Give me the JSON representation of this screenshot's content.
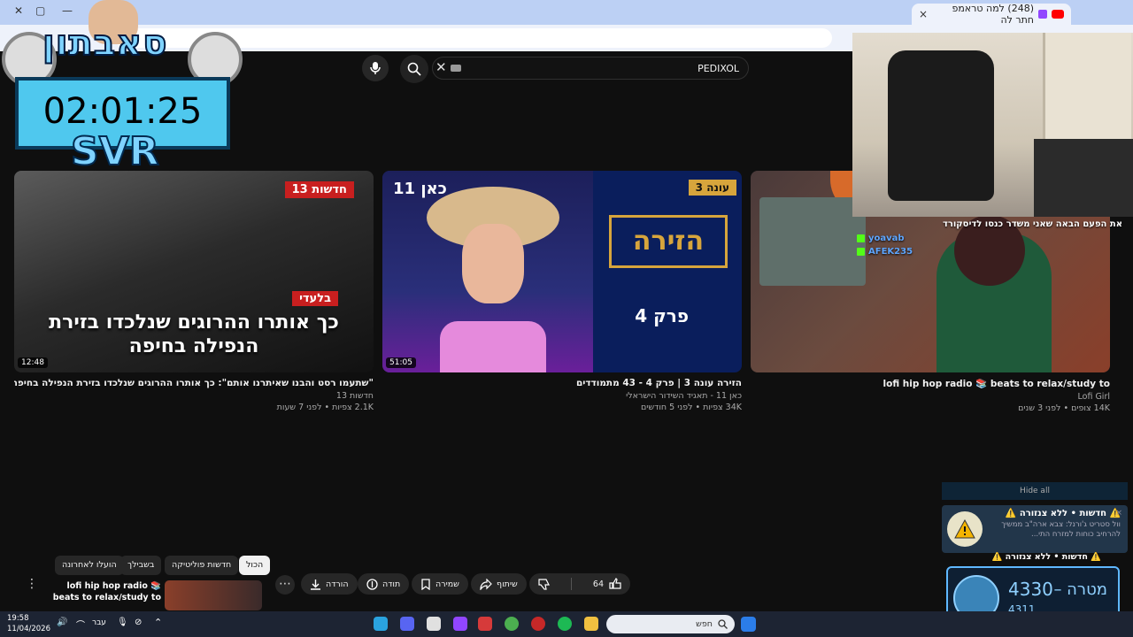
{
  "browser": {
    "tab_title": "(248) למה טראמפ חתר לה",
    "new_tab": "+",
    "tab_close": "×",
    "window_controls": [
      "▢",
      "—"
    ]
  },
  "youtube": {
    "search_value": "PEDIXOL",
    "videos": [
      {
        "thumb_badge": "חדשות 13",
        "thumb_exclusive": "בלעדי",
        "thumb_headline": "כך אותרו ההרוגים שנלכדו בזירת הנפילה בחיפה",
        "duration": "12:48",
        "title": "\"שתעמו רסט והבנו שאיתרנו אותם\": כך אותרו ההרוגים שנלכדו בזירת הנפילה בחיפה",
        "channel": "חדשות 13",
        "meta": "2.1K צפיות • לפני 7 שעות"
      },
      {
        "thumb_logo": "כאן 11",
        "thumb_season": "עונה 3",
        "thumb_show": "הזירה",
        "thumb_episode": "פרק 4",
        "duration": "51:05",
        "title": "הזירה עונה 3 | פרק 4 - 43 מתמודדים",
        "channel": "כאן 11 - תאגיד השידור הישראלי",
        "meta": "34K צפיות • לפני 5 חודשים"
      },
      {
        "duration": "",
        "title": "lofi hip hop radio 📚 beats to relax/study to",
        "channel": "Lofi Girl",
        "meta": "14K צופים • לפני 3 שנים"
      }
    ],
    "chips": [
      "הכול",
      "חדשות פוליטיקה",
      "בשבילך",
      "הועלו לאחרונה"
    ],
    "actions": {
      "likes": "64",
      "share": "שיתוף",
      "save": "שמירה",
      "thanks": "תודה",
      "download": "הורדה"
    },
    "mini_player_title": "lofi hip hop radio 📚 beats to relax/study to"
  },
  "overlay": {
    "streamer_name": "סאבתון",
    "timer": "02:01:25",
    "svr": "SVR",
    "chat_heading": "את הפעם הבאה שאני משדר כנסו לדיסקורד",
    "chat_users": [
      "yoavab",
      "AFEK235"
    ],
    "hide_all": "Hide all",
    "notification_title": "⚠️ חדשות • ללא צנזורה ⚠️",
    "notification_body": "וול סטריט ג'ורנל: צבא ארה\"ב ממשיך להרחיב כוחות למזרח התי...",
    "notification_peek": "⚠️ חדשות • ללא צנזורה ⚠️",
    "goal_label": "מטרה",
    "goal_value": "4330",
    "goal_current": "4311"
  },
  "taskbar": {
    "time": "19:58",
    "date": "11/04/2026",
    "lang": "עבר",
    "search": "חפש"
  }
}
